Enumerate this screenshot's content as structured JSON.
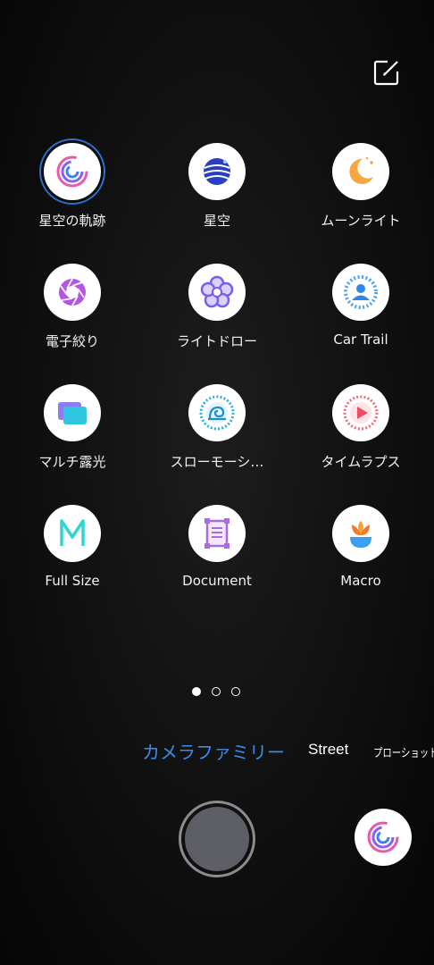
{
  "top_bar": {
    "edit_icon": "edit-square-icon"
  },
  "modes": [
    {
      "id": "star-trail",
      "label": "星空の軌跡",
      "icon": "star-trail-icon",
      "selected": true
    },
    {
      "id": "starry-sky",
      "label": "星空",
      "icon": "planet-icon",
      "selected": false
    },
    {
      "id": "moonlight",
      "label": "ムーンライト",
      "icon": "moon-icon",
      "selected": false
    },
    {
      "id": "aperture",
      "label": "電子絞り",
      "icon": "aperture-icon",
      "selected": false
    },
    {
      "id": "light-draw",
      "label": "ライトドロー",
      "icon": "flower-icon",
      "selected": false
    },
    {
      "id": "car-trail",
      "label": "Car Trail",
      "icon": "person-ring-icon",
      "selected": false
    },
    {
      "id": "multi-exposure",
      "label": "マルチ露光",
      "icon": "stacked-frames-icon",
      "selected": false
    },
    {
      "id": "slow-motion",
      "label": "スローモーシ…",
      "icon": "snail-icon",
      "selected": false
    },
    {
      "id": "timelapse",
      "label": "タイムラプス",
      "icon": "play-ring-icon",
      "selected": false
    },
    {
      "id": "full-size",
      "label": "Full Size",
      "icon": "letter-m-icon",
      "selected": false
    },
    {
      "id": "document",
      "label": "Document",
      "icon": "document-icon",
      "selected": false
    },
    {
      "id": "macro",
      "label": "Macro",
      "icon": "tulip-icon",
      "selected": false
    }
  ],
  "pager": {
    "pages": 3,
    "current": 1
  },
  "tabs": {
    "family": "カメラファミリー",
    "street": "Street",
    "pro": "プローショット"
  },
  "shutter": {
    "icon": "shutter-icon"
  },
  "quick_mode": {
    "icon": "star-trail-icon"
  },
  "colors": {
    "accent": "#3d8be8",
    "background": "#0c0c0c"
  }
}
